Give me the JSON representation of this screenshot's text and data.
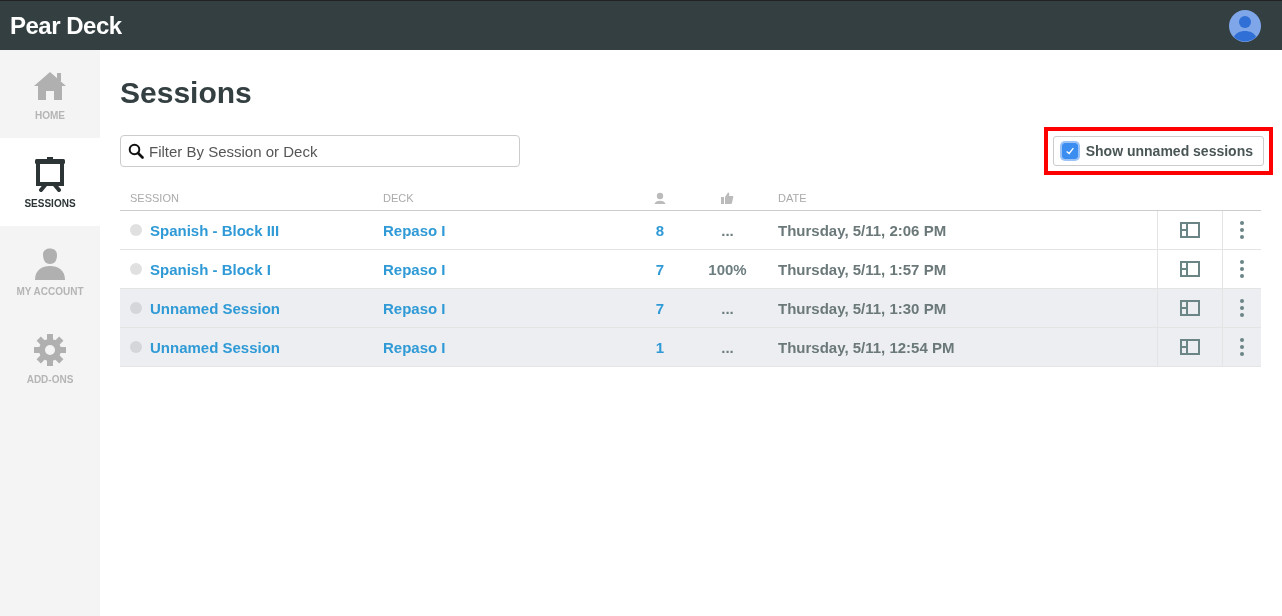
{
  "header": {
    "title": "Pear Deck"
  },
  "sidebar": {
    "items": [
      {
        "label": "HOME",
        "selected": false
      },
      {
        "label": "SESSIONS",
        "selected": true
      },
      {
        "label": "MY ACCOUNT",
        "selected": false
      },
      {
        "label": "ADD-ONS",
        "selected": false
      }
    ]
  },
  "page_title": "Sessions",
  "filter": {
    "placeholder": "Filter By Session or Deck"
  },
  "unnamed_toggle": {
    "label": "Show unnamed sessions",
    "checked": true,
    "highlighted": true
  },
  "table": {
    "columns": [
      "SESSION",
      "DECK",
      "",
      "",
      "DATE"
    ],
    "rows": [
      {
        "session": "Spanish - Block III",
        "deck": "Repaso I",
        "students": "8",
        "engagement": "...",
        "date": "Thursday, 5/11, 2:06 PM",
        "shaded": false
      },
      {
        "session": "Spanish - Block I",
        "deck": "Repaso I",
        "students": "7",
        "engagement": "100%",
        "date": "Thursday, 5/11, 1:57 PM",
        "shaded": false
      },
      {
        "session": "Unnamed Session",
        "deck": "Repaso I",
        "students": "7",
        "engagement": "...",
        "date": "Thursday, 5/11, 1:30 PM",
        "shaded": true
      },
      {
        "session": "Unnamed Session",
        "deck": "Repaso I",
        "students": "1",
        "engagement": "...",
        "date": "Thursday, 5/11, 12:54 PM",
        "shaded": true
      }
    ]
  }
}
